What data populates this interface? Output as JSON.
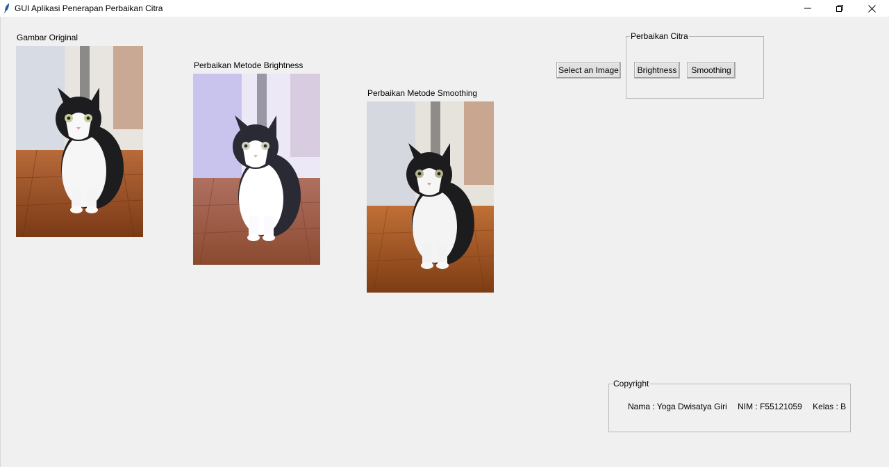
{
  "window": {
    "title": "GUI Aplikasi Penerapan Perbaikan Citra"
  },
  "images": {
    "original_label": "Gambar Original",
    "brightness_label": "Perbaikan Metode Brightness",
    "smoothing_label": "Perbaikan Metode Smoothing"
  },
  "controls": {
    "select_label": "Select an Image",
    "group_title": "Perbaikan Citra",
    "brightness_button": "Brightness",
    "smoothing_button": "Smoothing"
  },
  "copyright": {
    "title": "Copyright",
    "nama": "Nama : Yoga Dwisatya Giri",
    "nim": "NIM : F55121059",
    "kelas": "Kelas : B"
  },
  "icons": {
    "app": "feather-icon",
    "minimize": "minimize-icon",
    "restore": "restore-icon",
    "close": "close-icon"
  },
  "colors": {
    "background": "#f0f0f0",
    "button_face": "#e1e1e1"
  }
}
